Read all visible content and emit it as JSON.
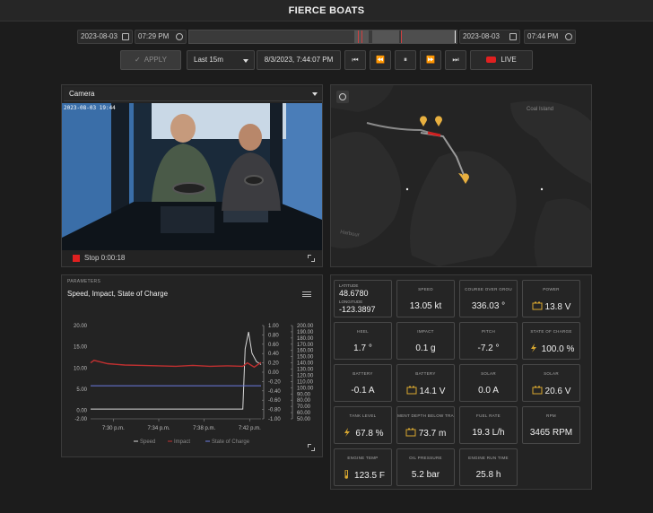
{
  "app": {
    "title": "FIERCE BOATS"
  },
  "time_range": {
    "start_date": "2023-08-03",
    "start_time": "07:29 PM",
    "end_date": "2023-08-03",
    "end_time": "07:44 PM"
  },
  "controls": {
    "apply_label": "APPLY",
    "range_value": "Last 15m",
    "current_timestamp": "8/3/2023, 7:44:07 PM",
    "live_label": "LIVE"
  },
  "camera": {
    "select_value": "Camera",
    "overlay_timestamp": "2023-08-03 19:44",
    "recording_status": "Stop 0:00:18"
  },
  "map": {
    "place_labels": [
      "Coal Island",
      "Harbour"
    ]
  },
  "parameters": {
    "section_label": "PARAMETERS",
    "chart_title": "Speed, Impact, State of Charge"
  },
  "chart_data": {
    "type": "line",
    "title": "Speed, Impact, State of Charge",
    "x_ticks": [
      "7:30 p.m.",
      "7:34 p.m.",
      "7:38 p.m.",
      "7:42 p.m."
    ],
    "left_axis": {
      "ticks": [
        "20.00",
        "15.00",
        "10.00",
        "5.00",
        "0.00",
        "-2.00"
      ],
      "ylim": [
        -2,
        20
      ]
    },
    "mid_axis": {
      "ticks": [
        "1.00",
        "0.80",
        "0.60",
        "0.40",
        "0.20",
        "0.00",
        "-0.20",
        "-0.40",
        "-0.60",
        "-0.80",
        "-1.00"
      ],
      "ylim": [
        -1,
        1
      ]
    },
    "right_axis": {
      "ticks": [
        "200.00",
        "190.00",
        "180.00",
        "170.00",
        "160.00",
        "150.00",
        "140.00",
        "130.00",
        "120.00",
        "110.00",
        "100.00",
        "90.00",
        "80.00",
        "70.00",
        "60.00",
        "50.00"
      ],
      "ylim": [
        50,
        200
      ]
    },
    "series": [
      {
        "name": "Speed",
        "color": "#d8d8d8",
        "x": [
          0,
          13.4,
          13.6,
          13.9,
          14.2,
          14.6,
          15
        ],
        "values": [
          0.3,
          0.3,
          14.5,
          18.5,
          13.5,
          11.5,
          10.8
        ]
      },
      {
        "name": "Impact",
        "color": "#c03030",
        "x": [
          0,
          0.3,
          1.5,
          3,
          4.5,
          6,
          7.5,
          9,
          10.5,
          12,
          13.4,
          13.8,
          14.4,
          15
        ],
        "values": [
          11.2,
          11.8,
          11,
          10.7,
          10.6,
          10.5,
          10.4,
          10.6,
          10.4,
          10.5,
          10.4,
          11.2,
          10.2,
          11.3
        ]
      },
      {
        "name": "State of Charge",
        "color": "#6c7ce0",
        "x": [
          0,
          15
        ],
        "values": [
          5.8,
          5.8
        ]
      }
    ],
    "x_range_minutes": [
      0,
      15
    ],
    "legend": [
      "Speed",
      "Impact",
      "State of Charge"
    ],
    "legend_placement": "bottom-center"
  },
  "telemetry": {
    "coords": {
      "lat_label": "LATITUDE",
      "lat": "48.6780",
      "lon_label": "LONGITUDE",
      "lon": "-123.3897"
    },
    "tiles": [
      {
        "label": "SPEED",
        "value": "13.05 kt",
        "icon": ""
      },
      {
        "label": "COURSE OVER GROU",
        "value": "336.03 °",
        "icon": ""
      },
      {
        "label": "POWER",
        "value": "13.8 V",
        "icon": "battery-icon"
      },
      {
        "label": "HEEL",
        "value": "1.7 °",
        "icon": ""
      },
      {
        "label": "IMPACT",
        "value": "0.1 g",
        "icon": ""
      },
      {
        "label": "PITCH",
        "value": "-7.2 °",
        "icon": ""
      },
      {
        "label": "STATE OF CHARGE",
        "value": "100.0 %",
        "icon": "bolt-icon"
      },
      {
        "label": "BATTERY",
        "value": "-0.1 A",
        "icon": ""
      },
      {
        "label": "BATTERY",
        "value": "14.1 V",
        "icon": "battery-icon"
      },
      {
        "label": "SOLAR",
        "value": "0.0 A",
        "icon": ""
      },
      {
        "label": "SOLAR",
        "value": "20.6 V",
        "icon": "battery-icon"
      },
      {
        "label": "TANK LEVEL",
        "value": "67.8 %",
        "icon": "bolt-icon"
      },
      {
        "label": "MENT DEPTH BELOW TRA",
        "value": "73.7 m",
        "icon": "battery-icon"
      },
      {
        "label": "FUEL RATE",
        "value": "19.3 L/h",
        "icon": ""
      },
      {
        "label": "RPM",
        "value": "3465 RPM",
        "icon": ""
      },
      {
        "label": "ENGINE TEMP",
        "value": "123.5 F",
        "icon": "thermometer-icon"
      },
      {
        "label": "OIL PRESSURE",
        "value": "5.2 bar",
        "icon": ""
      },
      {
        "label": "ENGINE RUN TIME",
        "value": "25.8 h",
        "icon": ""
      }
    ]
  }
}
